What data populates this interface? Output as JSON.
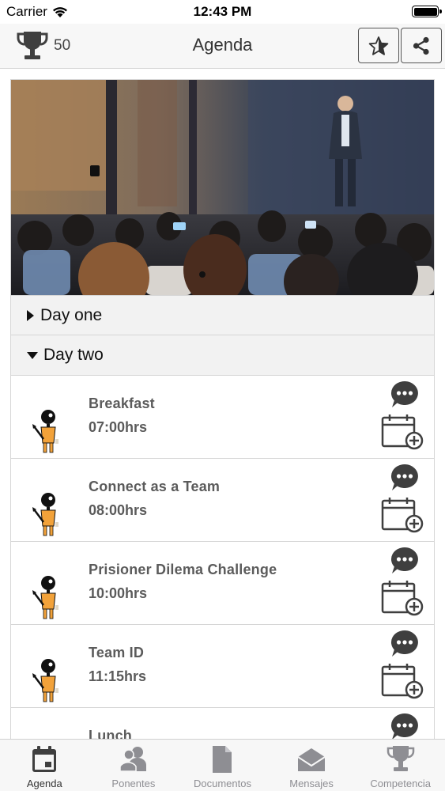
{
  "status_bar": {
    "carrier": "Carrier",
    "time": "12:43 PM"
  },
  "nav": {
    "points": "50",
    "title": "Agenda"
  },
  "days": [
    {
      "label": "Day one",
      "expanded": false
    },
    {
      "label": "Day two",
      "expanded": true
    }
  ],
  "sessions": [
    {
      "title": "Breakfast",
      "time": "07:00hrs"
    },
    {
      "title": "Connect as a Team",
      "time": "08:00hrs"
    },
    {
      "title": "Prisioner Dilema Challenge",
      "time": "10:00hrs"
    },
    {
      "title": "Team ID",
      "time": "11:15hrs"
    },
    {
      "title": "Lunch",
      "time": ""
    }
  ],
  "tabs": [
    {
      "label": "Agenda",
      "icon": "calendar-icon",
      "active": true
    },
    {
      "label": "Ponentes",
      "icon": "people-icon",
      "active": false
    },
    {
      "label": "Documentos",
      "icon": "document-icon",
      "active": false
    },
    {
      "label": "Mensajes",
      "icon": "envelope-icon",
      "active": false
    },
    {
      "label": "Competencia",
      "icon": "trophy-icon",
      "active": false
    }
  ],
  "colors": {
    "icon_dark": "#3f3f3f",
    "tab_inactive": "#8e8e93",
    "avatar_orange": "#f2a23a"
  }
}
